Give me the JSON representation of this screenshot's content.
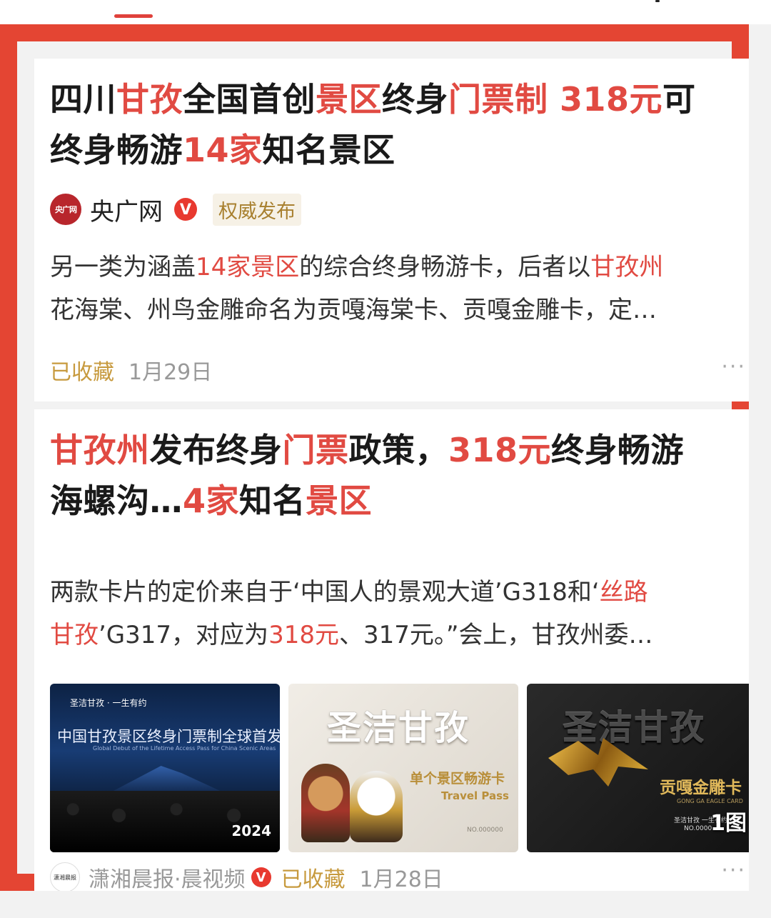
{
  "cards": [
    {
      "title_line1": [
        {
          "text": "四川",
          "hl": false
        },
        {
          "text": "甘孜",
          "hl": true
        },
        {
          "text": "全国首创",
          "hl": false
        },
        {
          "text": "景区",
          "hl": true
        },
        {
          "text": "终身",
          "hl": false
        },
        {
          "text": "门票制 318元",
          "hl": true
        },
        {
          "text": "可",
          "hl": false
        }
      ],
      "title_line2": [
        {
          "text": "终身畅游",
          "hl": false
        },
        {
          "text": "14家",
          "hl": true
        },
        {
          "text": "知名景区",
          "hl": false
        }
      ],
      "source": {
        "logo_text": "央广网",
        "name": "央广网",
        "verified_mark": "V",
        "badge": "权威发布"
      },
      "excerpt_line1": [
        {
          "text": "另一类为涵盖",
          "hl": false
        },
        {
          "text": "14家景区",
          "hl": true
        },
        {
          "text": "的综合终身畅游卡，后者以",
          "hl": false
        },
        {
          "text": "甘孜州",
          "hl": true
        }
      ],
      "excerpt_line2": [
        {
          "text": "花海棠、州鸟金雕命名为贡嘎海棠卡、贡嘎金雕卡，定…",
          "hl": false
        }
      ],
      "saved_label": "已收藏",
      "date": "1月29日",
      "more_label": "···"
    },
    {
      "title_line1": [
        {
          "text": "甘孜州",
          "hl": true
        },
        {
          "text": "发布终身",
          "hl": false
        },
        {
          "text": "门票",
          "hl": true
        },
        {
          "text": "政策，",
          "hl": false
        },
        {
          "text": "318元",
          "hl": true
        },
        {
          "text": "终身畅游",
          "hl": false
        }
      ],
      "title_line2": [
        {
          "text": "海螺沟…",
          "hl": false
        },
        {
          "text": "4家",
          "hl": true
        },
        {
          "text": "知名",
          "hl": false
        },
        {
          "text": "景区",
          "hl": true
        }
      ],
      "excerpt_line1": [
        {
          "text": "两款卡片的定价来自于‘中国人的景观大道’G318和‘",
          "hl": false
        },
        {
          "text": "丝路",
          "hl": true
        }
      ],
      "excerpt_line2": [
        {
          "text": "甘孜",
          "hl": true
        },
        {
          "text": "’G317，对应为",
          "hl": false
        },
        {
          "text": "318元",
          "hl": true
        },
        {
          "text": "、317元。”会上，甘孜州委…",
          "hl": false
        }
      ],
      "images": [
        {
          "icon": "event-stage-photo",
          "headline": "中国甘孜景区终身门票制全球首发",
          "sub": "圣洁甘孜 · 一生有约",
          "tiny": "Global Debut of the Lifetime Access Pass for China Scenic Areas",
          "year": "2024"
        },
        {
          "icon": "travel-pass-card",
          "brand": "圣洁甘孜",
          "card_name": "单个景区畅游卡",
          "card_en": "Travel Pass",
          "number": "NO.000000"
        },
        {
          "icon": "eagle-card",
          "brand": "圣洁甘孜",
          "card_name": "贡嘎金雕卡",
          "card_en": "GONG GA EAGLE CARD",
          "small": "圣洁甘孜 一生有约",
          "number": "NO.0000",
          "count_label": "1图"
        }
      ],
      "source": {
        "logo_text": "潇湘晨报",
        "name": "潇湘晨报·晨视频",
        "verified_mark": "V"
      },
      "saved_label": "已收藏",
      "date": "1月28日",
      "more_label": "···"
    }
  ],
  "colors": {
    "highlight": "#e14a42",
    "frame": "#e44533",
    "saved": "#c79a3e",
    "verified": "#e8392f"
  }
}
